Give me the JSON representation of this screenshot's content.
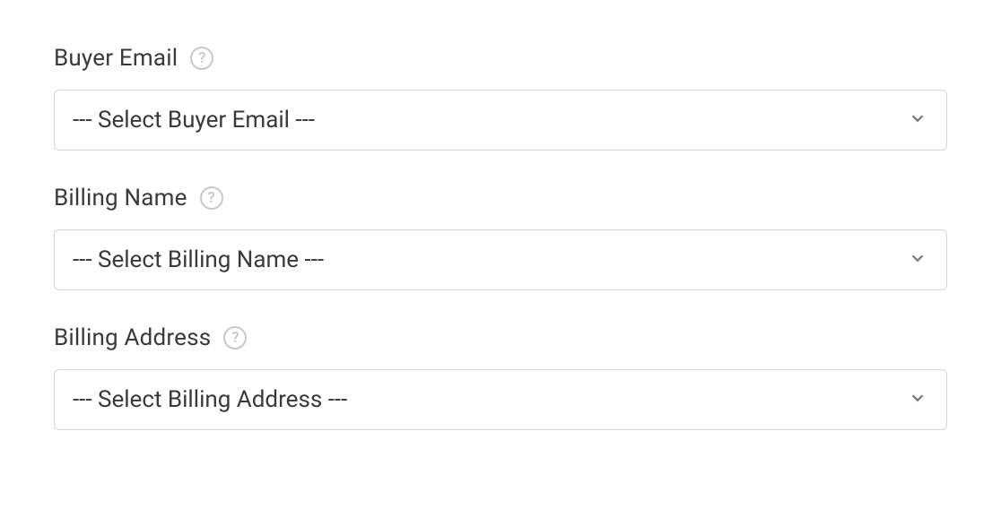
{
  "fields": [
    {
      "label": "Buyer Email",
      "placeholder": "--- Select Buyer Email ---",
      "name": "buyer-email"
    },
    {
      "label": "Billing Name",
      "placeholder": "--- Select Billing Name ---",
      "name": "billing-name"
    },
    {
      "label": "Billing Address",
      "placeholder": "--- Select Billing Address ---",
      "name": "billing-address"
    }
  ]
}
